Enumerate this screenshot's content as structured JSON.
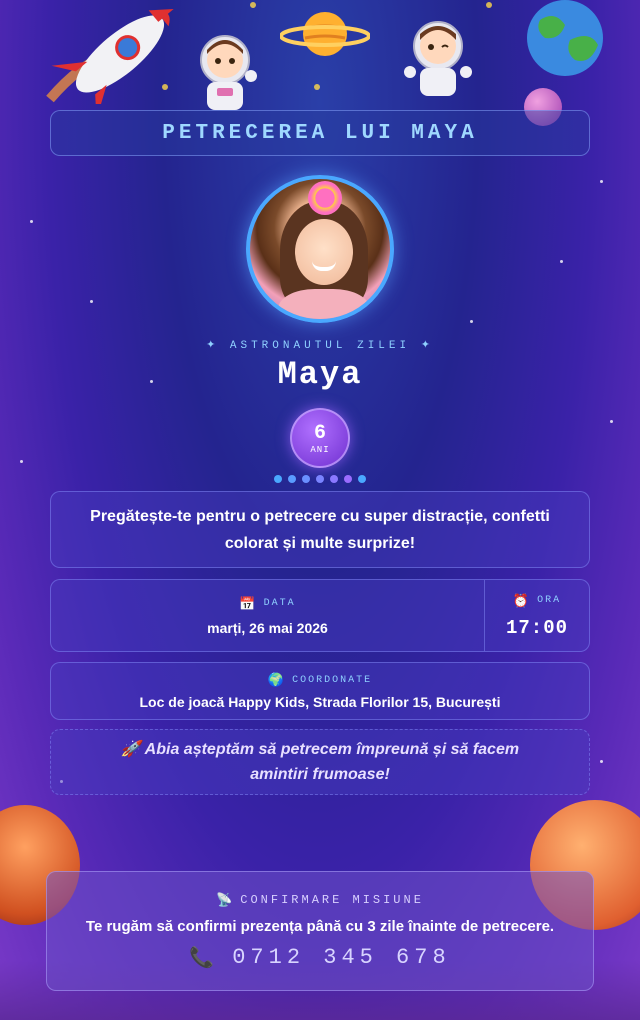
{
  "header": {
    "title": "PETRECEREA LUI MAYA"
  },
  "hero": {
    "subtitle": "✦ ASTRONAUTUL ZILEI ✦",
    "name": "Maya",
    "age_number": "6",
    "age_unit": "ANI"
  },
  "dots": {
    "colors": [
      "#4aa8ff",
      "#5a9cff",
      "#6a90ff",
      "#7a84ff",
      "#8a78ff",
      "#9a6cff",
      "#4aa8ff"
    ]
  },
  "intro": {
    "text": "Pregătește-te pentru o petrecere cu super distracție, confetti colorat și multe surprize!"
  },
  "date": {
    "icon": "📅",
    "label": "DATA",
    "value": "marți, 26 mai 2026"
  },
  "time": {
    "icon": "⏰",
    "label": "ORA",
    "value": "17:00"
  },
  "location": {
    "icon": "🌍",
    "label": "COORDONATE",
    "value": "Loc de joacă Happy Kids, Strada Florilor 15, București"
  },
  "message": {
    "text": "🚀 Abia așteptăm să petrecem împreună și să facem amintiri frumoase!"
  },
  "rsvp": {
    "icon": "📡",
    "label": "CONFIRMARE MISIUNE",
    "text": "Te rugăm să confirmi prezența până cu 3 zile înainte de petrecere.",
    "phone_icon": "📞",
    "phone": "0712 345 678"
  },
  "colors": {
    "accent": "#8fd0ff",
    "photo_border": "#4aa8ff",
    "age_badge": "#7030d0"
  }
}
